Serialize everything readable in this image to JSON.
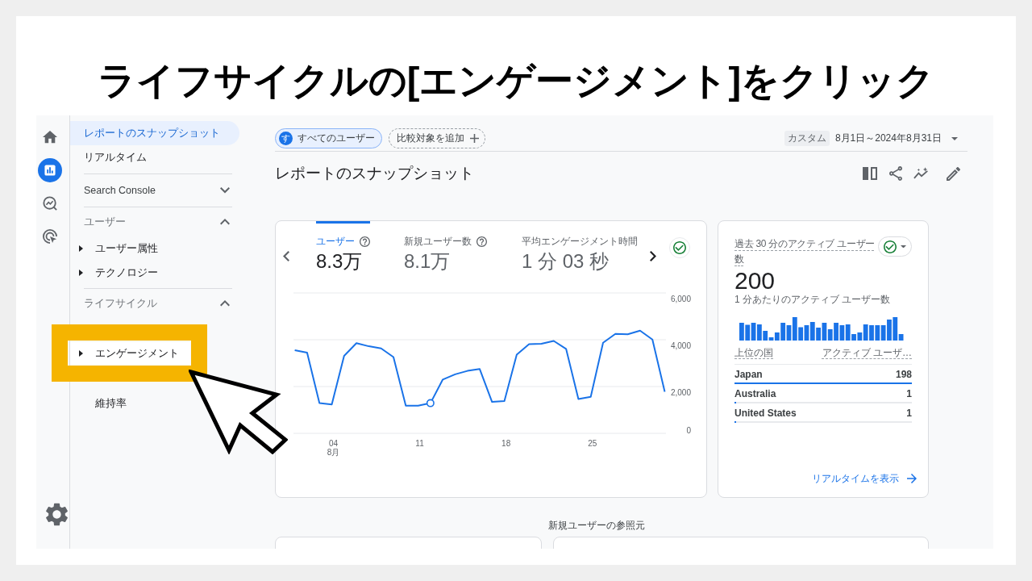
{
  "slide": {
    "title": "ライフサイクルの[エンゲージメント]をクリック"
  },
  "rail": {
    "items": [
      {
        "selected": false
      },
      {
        "selected": true
      },
      {
        "selected": false
      },
      {
        "selected": false
      }
    ]
  },
  "sidebar": {
    "items": [
      {
        "kind": "link",
        "label": "レポートのスナップショット",
        "selected": true
      },
      {
        "kind": "link",
        "label": "リアルタイム",
        "selected": false
      },
      {
        "kind": "section",
        "label": "Search Console",
        "expanded": false
      },
      {
        "kind": "section",
        "label": "ユーザー",
        "expanded": true,
        "children": [
          {
            "kind": "group",
            "label": "ユーザー属性",
            "expanded": false,
            "selected": false,
            "highlighted": false
          },
          {
            "kind": "group",
            "label": "テクノロジー",
            "expanded": false,
            "selected": false,
            "highlighted": false
          }
        ]
      },
      {
        "kind": "section",
        "label": "ライフサイクル",
        "expanded": true,
        "children": [
          {
            "kind": "group",
            "label": "エンゲージメント",
            "expanded": false,
            "selected": false,
            "highlighted": true
          },
          {
            "kind": "page",
            "label": "維持率",
            "selected": false,
            "highlighted": false
          }
        ]
      }
    ]
  },
  "filters": [
    {
      "kind": "segment",
      "avatar": "す",
      "label": "すべてのユーザー"
    },
    {
      "kind": "add",
      "label": "比較対象を追加"
    }
  ],
  "date_range": {
    "preset": "カスタム",
    "range": "8月1日～2024年8月31日"
  },
  "page_title": "レポートのスナップショット",
  "overview_card": {
    "metrics": [
      {
        "label": "ユーザー",
        "value": "8.3万",
        "has_help": true,
        "selected": true
      },
      {
        "label": "新規ユーザー数",
        "value": "8.1万",
        "has_help": true,
        "selected": false
      },
      {
        "label": "平均エンゲージメント時間",
        "value": "1 分 03 秒",
        "has_help": false,
        "selected": false
      }
    ],
    "month_label": "8月",
    "chart_data": {
      "type": "line",
      "x": [
        1,
        2,
        3,
        4,
        5,
        6,
        7,
        8,
        9,
        10,
        11,
        12,
        13,
        14,
        15,
        16,
        17,
        18,
        19,
        20,
        21,
        22,
        23,
        24,
        25,
        26,
        27,
        28,
        29,
        30,
        31
      ],
      "values": [
        3550,
        3450,
        1290,
        1230,
        3310,
        3850,
        3720,
        3630,
        3260,
        1180,
        1180,
        1290,
        2300,
        2520,
        2670,
        2750,
        1340,
        1380,
        3360,
        3810,
        3830,
        3950,
        3610,
        1470,
        1560,
        3870,
        4250,
        4230,
        4390,
        4010,
        1780
      ],
      "xlim": [
        1,
        31
      ],
      "ylim": [
        0,
        6000
      ],
      "xticks": [
        {
          "value": 4,
          "label": "04"
        },
        {
          "value": 11,
          "label": "11"
        },
        {
          "value": 18,
          "label": "18"
        },
        {
          "value": 25,
          "label": "25"
        }
      ],
      "yticks": [
        {
          "value": 0,
          "label": "0"
        },
        {
          "value": 2000,
          "label": "2,000"
        },
        {
          "value": 4000,
          "label": "4,000"
        },
        {
          "value": 6000,
          "label": "6,000"
        }
      ]
    }
  },
  "realtime_card": {
    "title": "過去 30 分のアクティブ ユーザー数",
    "value": "200",
    "subtitle": "1 分あたりのアクティブ ユーザー数",
    "columns": [
      "上位の国",
      "アクティブ ユーザ…"
    ],
    "rows": [
      {
        "country": "Japan",
        "count": "198",
        "level": 1.0
      },
      {
        "country": "Australia",
        "count": "1",
        "level": 0.005
      },
      {
        "country": "United States",
        "count": "1",
        "level": 0.005
      }
    ],
    "link": "リアルタイムを表示"
  },
  "referrals": {
    "title": "新規ユーザーの参照元"
  }
}
